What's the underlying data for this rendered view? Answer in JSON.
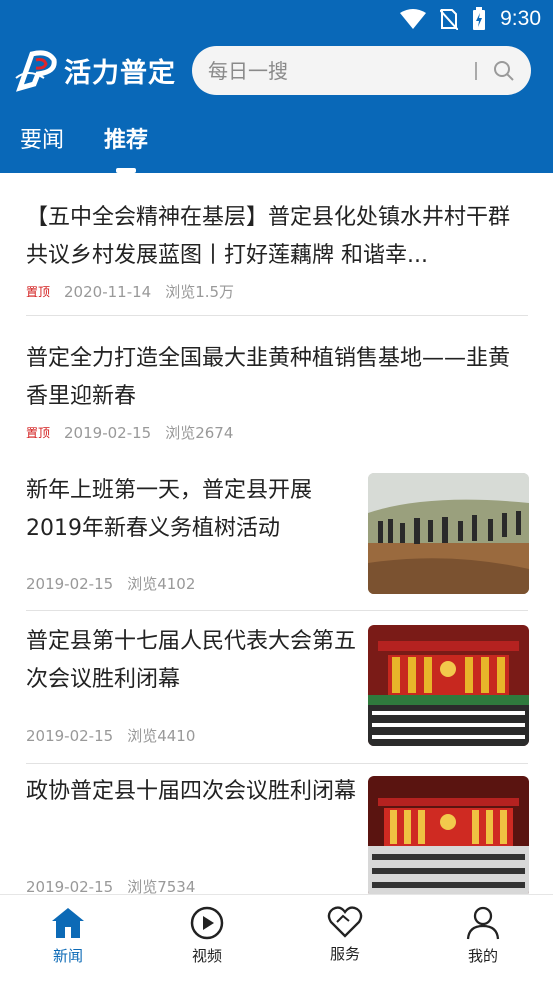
{
  "status": {
    "time": "9:30"
  },
  "header": {
    "app_name": "活力普定",
    "search_placeholder": "每日一搜"
  },
  "tabs": [
    {
      "label": "要闻"
    },
    {
      "label": "推荐"
    }
  ],
  "feed": [
    {
      "title": "【五中全会精神在基层】普定县化处镇水井村干群共议乡村发展蓝图丨打好莲藕牌 和谐幸...",
      "badge": "置顶",
      "date": "2020-11-14",
      "views": "浏览1.5万"
    },
    {
      "title": "普定全力打造全国最大韭黄种植销售基地——韭黄香里迎新春",
      "badge": "置顶",
      "date": "2019-02-15",
      "views": "浏览2674"
    },
    {
      "title": "新年上班第一天，普定县开展2019年新春义务植树活动",
      "date": "2019-02-15",
      "views": "浏览4102"
    },
    {
      "title": "普定县第十七届人民代表大会第五次会议胜利闭幕",
      "date": "2019-02-15",
      "views": "浏览4410"
    },
    {
      "title": "政协普定县十届四次会议胜利闭幕",
      "date": "2019-02-15",
      "views": "浏览7534"
    }
  ],
  "bottom_nav": [
    {
      "label": "新闻",
      "icon": "home-icon",
      "active": true
    },
    {
      "label": "视频",
      "icon": "play-icon"
    },
    {
      "label": "服务",
      "icon": "heart-icon"
    },
    {
      "label": "我的",
      "icon": "user-icon"
    }
  ],
  "colors": {
    "brand": "#0968b8",
    "badge": "#d21b1b"
  }
}
